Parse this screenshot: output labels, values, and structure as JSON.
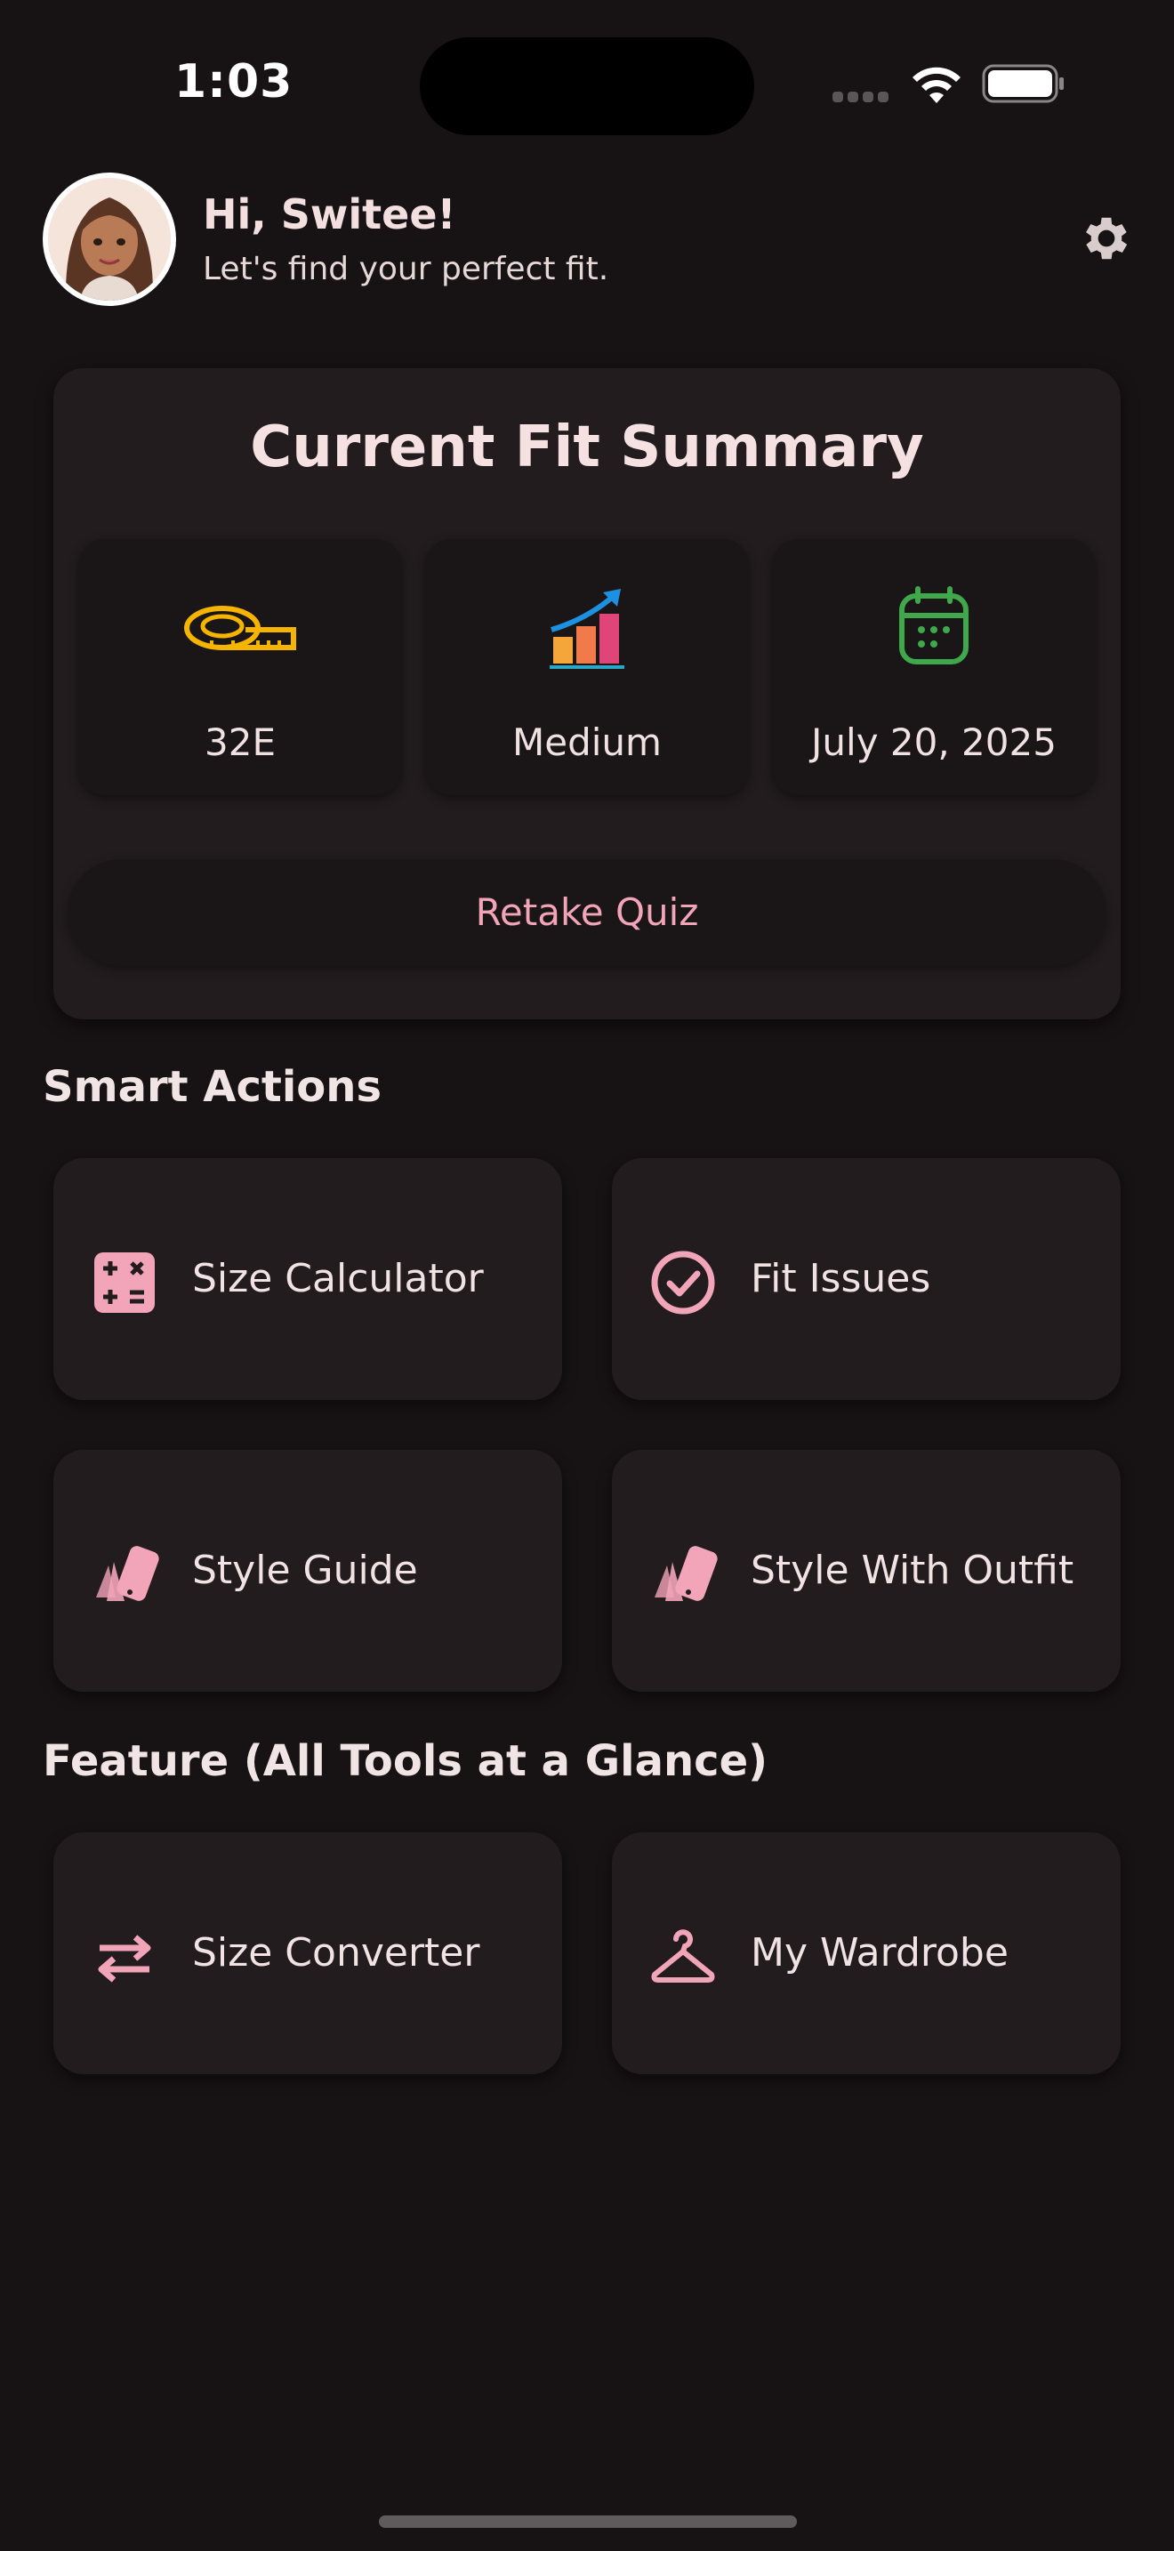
{
  "status_bar": {
    "time": "1:03"
  },
  "header": {
    "greeting": "Hi, Switee!",
    "subtitle": "Let's find your perfect fit.",
    "avatar_icon": "avatar",
    "settings_icon": "gear-icon"
  },
  "summary": {
    "title": "Current Fit Summary",
    "stats": [
      {
        "icon": "measuring-tape-icon",
        "label": "32E",
        "color": "#f5b400"
      },
      {
        "icon": "growth-chart-icon",
        "label": "Medium",
        "color": "#f08a3c"
      },
      {
        "icon": "calendar-icon",
        "label": "July 20, 2025",
        "color": "#3fa84a"
      }
    ],
    "retake_label": "Retake Quiz"
  },
  "smart_actions": {
    "title": "Smart Actions",
    "items": [
      {
        "icon": "calculator-icon",
        "label": "Size Calculator"
      },
      {
        "icon": "check-circle-icon",
        "label": "Fit Issues"
      },
      {
        "icon": "swatch-icon",
        "label": "Style Guide"
      },
      {
        "icon": "swatch-icon",
        "label": "Style With Outfit"
      }
    ]
  },
  "features": {
    "title": "Feature (All Tools at a Glance)",
    "items": [
      {
        "icon": "swap-arrows-icon",
        "label": "Size Converter"
      },
      {
        "icon": "hanger-icon",
        "label": "My Wardrobe"
      }
    ]
  },
  "colors": {
    "background": "#171213",
    "card": "#221c1e",
    "accent": "#f2a4b8"
  }
}
